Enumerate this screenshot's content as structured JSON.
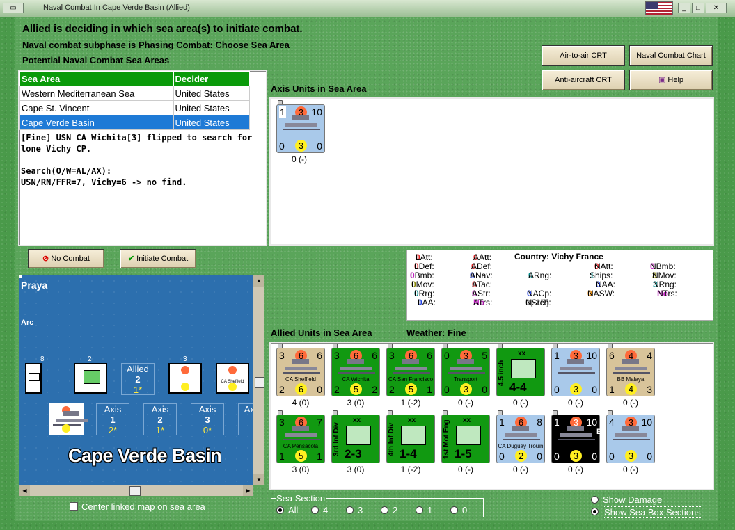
{
  "window": {
    "title": "Naval Combat In Cape Verde Basin (Allied)"
  },
  "header": {
    "line1": "Allied is deciding in which sea area(s) to initiate combat.",
    "line2": "Naval combat subphase is Phasing Combat: Choose Sea Area",
    "line3": "Potential Naval Combat Sea Areas"
  },
  "buttons": {
    "air_to_air": "Air-to-air CRT",
    "naval_chart": "Naval Combat Chart",
    "anti_aircraft": "Anti-aircraft CRT",
    "help": "Help",
    "no_combat": "No Combat",
    "initiate": "Initiate Combat"
  },
  "sea_areas": {
    "headers": [
      "Sea Area",
      "Decider"
    ],
    "rows": [
      {
        "area": "Western Mediterranean Sea",
        "decider": "United States"
      },
      {
        "area": "Cape St. Vincent",
        "decider": "United States"
      },
      {
        "area": "Cape Verde Basin",
        "decider": "United States"
      }
    ]
  },
  "log": "[Fine] USN CA Wichita[3] flipped to search for lone Vichy CP.\n\nSearch(O/W=AL/AX):\nUSN/RN/FFR=7, Vichy=6 -> no find.",
  "axis": {
    "label": "Axis Units in Sea Area",
    "unit": {
      "tl": "1",
      "tc": "3",
      "tr": "10",
      "bl": "0",
      "bc": "3",
      "br": "0",
      "under": "0 (-)"
    }
  },
  "stats": {
    "country_label": "Country: Vichy France",
    "LAtt": "0",
    "LDef": "0",
    "LBmb": "0",
    "LMov": "0",
    "LRrg": "0",
    "LAA": "0",
    "AAtt": "0",
    "ADef": "0",
    "ANav": "0",
    "ATac": "0",
    "AStr": "0",
    "ATrs": "No",
    "ARng": "0",
    "NACp": "0",
    "NSrch": "0(-1R)",
    "NAtt": "0",
    "Ships": "1",
    "NAA": "0",
    "NASW": "0",
    "NBmb": "0",
    "NMov": "3",
    "NRng": "3",
    "NTrs": "No"
  },
  "allied": {
    "label": "Allied Units in Sea Area",
    "weather": "Weather:  Fine",
    "row1": [
      {
        "name": "CA Sheffield",
        "tl": "3",
        "tc": "6",
        "tr": "6",
        "bl": "2",
        "bc": "6",
        "br": "0",
        "under": "4 (0)"
      },
      {
        "name": "CA Wichita",
        "tl": "3",
        "tc": "6",
        "tr": "6",
        "bl": "2",
        "bc": "5",
        "br": "2",
        "under": "3 (0)"
      },
      {
        "name": "CA San Francisco",
        "tl": "3",
        "tc": "6",
        "tr": "6",
        "bl": "2",
        "bc": "5",
        "br": "1",
        "under": "1 (-2)"
      },
      {
        "name": "Transport",
        "tl": "0",
        "tc": "3",
        "tr": "5",
        "bl": "0",
        "bc": "3",
        "br": "0",
        "under": "0 (-)"
      },
      {
        "name": "4.5 inch",
        "tl": "",
        "tc": "xx",
        "tr": "",
        "bl": "",
        "bc": "4-4",
        "br": "",
        "under": "0 (-)"
      },
      {
        "name": "",
        "tl": "1",
        "tc": "3",
        "tr": "10",
        "bl": "0",
        "bc": "3",
        "br": "0",
        "under": "0 (-)"
      },
      {
        "name": "BB Malaya",
        "tl": "6",
        "tc": "4",
        "tr": "4",
        "bl": "1",
        "bc": "4",
        "br": "3",
        "under": "0 (-)"
      }
    ],
    "row2": [
      {
        "name": "CA Pensacola",
        "tl": "3",
        "tc": "6",
        "tr": "7",
        "bl": "1",
        "bc": "5",
        "br": "1",
        "under": "3 (0)"
      },
      {
        "name": "3rd Inf Div",
        "tl": "",
        "tc": "xx",
        "tr": "",
        "bl": "",
        "bc": "2-3",
        "br": "",
        "under": "3 (0)"
      },
      {
        "name": "4th Inf Div",
        "tl": "",
        "tc": "xx",
        "tr": "",
        "bl": "",
        "bc": "1-4",
        "br": "",
        "under": "1 (-2)"
      },
      {
        "name": "1st Mot Eng",
        "tl": "",
        "tc": "xx",
        "tr": "",
        "bl": "",
        "bc": "1-5",
        "br": "",
        "under": "0 (-)"
      },
      {
        "name": "CA Duguay Trouin",
        "tl": "1",
        "tc": "6",
        "tr": "8",
        "bl": "0",
        "bc": "2",
        "br": "0",
        "under": "0 (-)"
      },
      {
        "name": "BEL",
        "tl": "1",
        "tc": "3",
        "tr": "10",
        "bl": "0",
        "bc": "3",
        "br": "0",
        "under": "0 (-)"
      },
      {
        "name": "",
        "tl": "4",
        "tc": "3",
        "tr": "10",
        "bl": "0",
        "bc": "3",
        "br": "0",
        "under": "0 (-)"
      }
    ]
  },
  "map": {
    "place": "Praya",
    "area_name": "Cape Verde Basin",
    "partial_label": "Arc",
    "allied_box": {
      "label": "Allied",
      "num": "2",
      "sub": "1*"
    },
    "axis_boxes": [
      {
        "label": "Axis",
        "num": "1",
        "sub": "2*"
      },
      {
        "label": "Axis",
        "num": "2",
        "sub": "1*"
      },
      {
        "label": "Axis",
        "num": "3",
        "sub": "0*"
      }
    ],
    "stack_counts": [
      "8",
      "2",
      "3"
    ],
    "counters": {
      "land1": "1-5",
      "land2": "1-4",
      "wichita": "CA Wichita",
      "sheffield": "CA Sheffield"
    }
  },
  "options": {
    "center_map": "Center linked map on sea area",
    "sea_section": "Sea Section",
    "sections": [
      "All",
      "4",
      "3",
      "2",
      "1",
      "0"
    ],
    "show_damage": "Show Damage",
    "show_boxes": "Show Sea Box Sections"
  }
}
